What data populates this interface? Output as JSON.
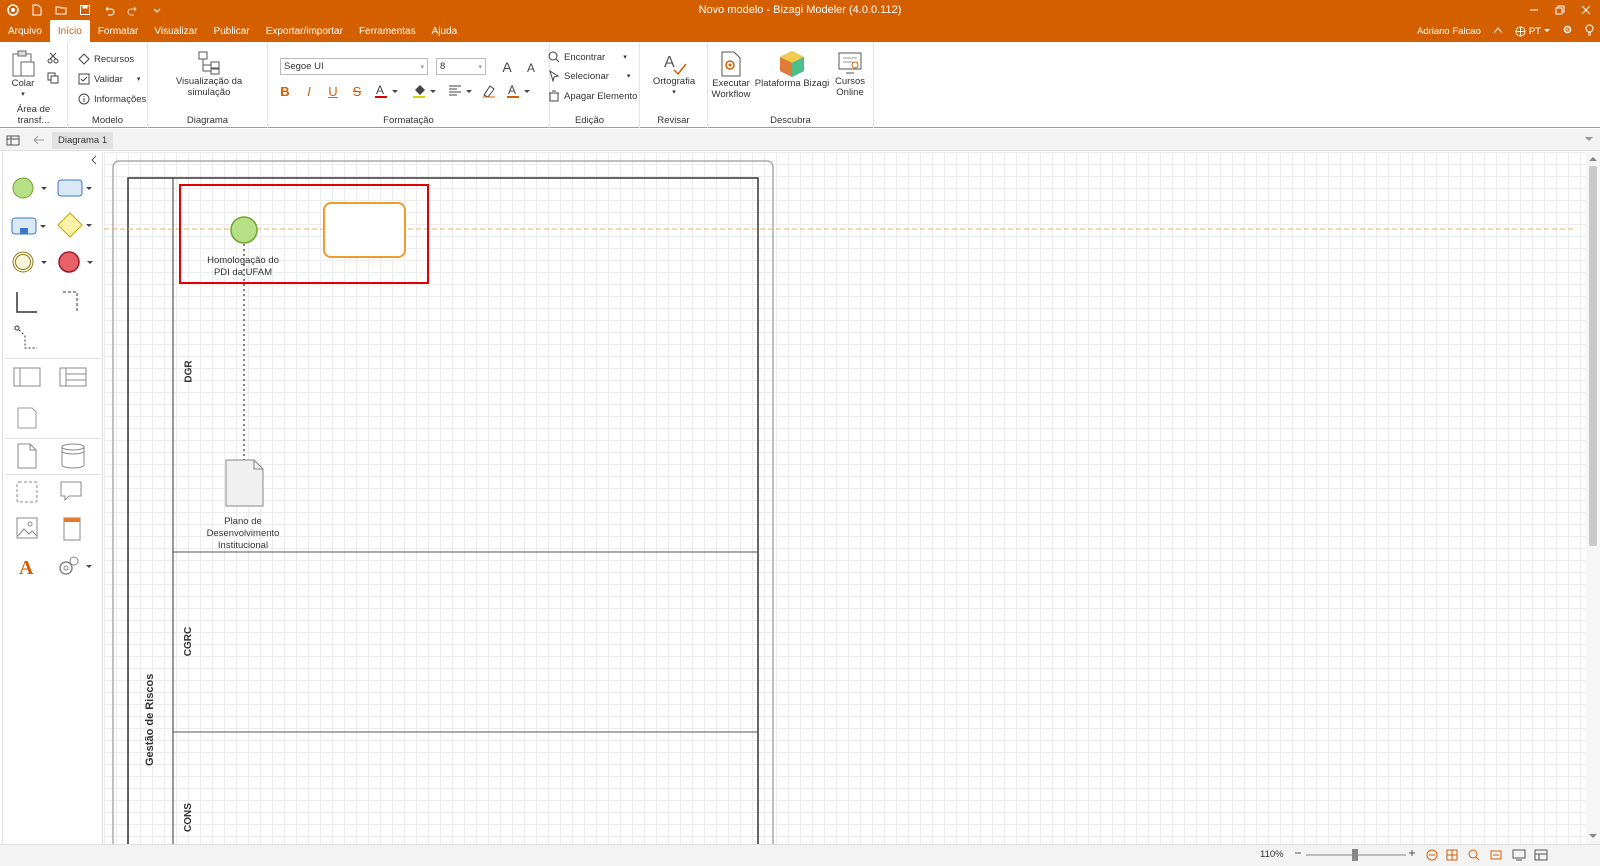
{
  "window": {
    "title": "Novo modelo - Bizagi Modeler (4.0.0.112)"
  },
  "menu": {
    "tabs": [
      "Arquivo",
      "Início",
      "Formatar",
      "Visualizar",
      "Publicar",
      "Exportar/importar",
      "Ferramentas",
      "Ajuda"
    ],
    "active": "Início",
    "user": "Adriano Falcao",
    "language": "PT"
  },
  "ribbon": {
    "clipboard": {
      "paste": "Colar",
      "label": "Área de transf..."
    },
    "model": {
      "resources": "Recursos",
      "validate": "Validar",
      "info": "Informações",
      "label": "Modelo"
    },
    "diagram": {
      "simulation": "Visualização da simulação",
      "label": "Diagrama"
    },
    "format": {
      "font": "Segoe UI",
      "size": "8",
      "label": "Formatação"
    },
    "edit": {
      "find": "Encontrar",
      "select": "Selecionar",
      "delete": "Apagar Elemento",
      "label": "Edição"
    },
    "review": {
      "spelling": "Ortografia",
      "label": "Revisar"
    },
    "discover": {
      "workflow_line1": "Executar",
      "workflow_line2": "Workflow",
      "platform": "Plataforma Bizagi",
      "courses_line1": "Cursos",
      "courses_line2": "Online",
      "label": "Descubra"
    }
  },
  "tabstrip": {
    "doc_tab": "Diagrama 1"
  },
  "diagram": {
    "pool_name": "Gestão de Riscos",
    "lanes": [
      "DGR",
      "CGRC",
      "CONS"
    ],
    "start_event": {
      "label_line1": "Homologação do",
      "label_line2": "PDI da UFAM"
    },
    "document": {
      "label_line1": "Plano de",
      "label_line2": "Desenvolvimento",
      "label_line3": "Institucional"
    }
  },
  "status": {
    "zoom": "110%"
  },
  "colors": {
    "accent": "#d45f00",
    "start_fill": "#b5e085",
    "task_border": "#f39a2c",
    "selection": "#e00000"
  }
}
